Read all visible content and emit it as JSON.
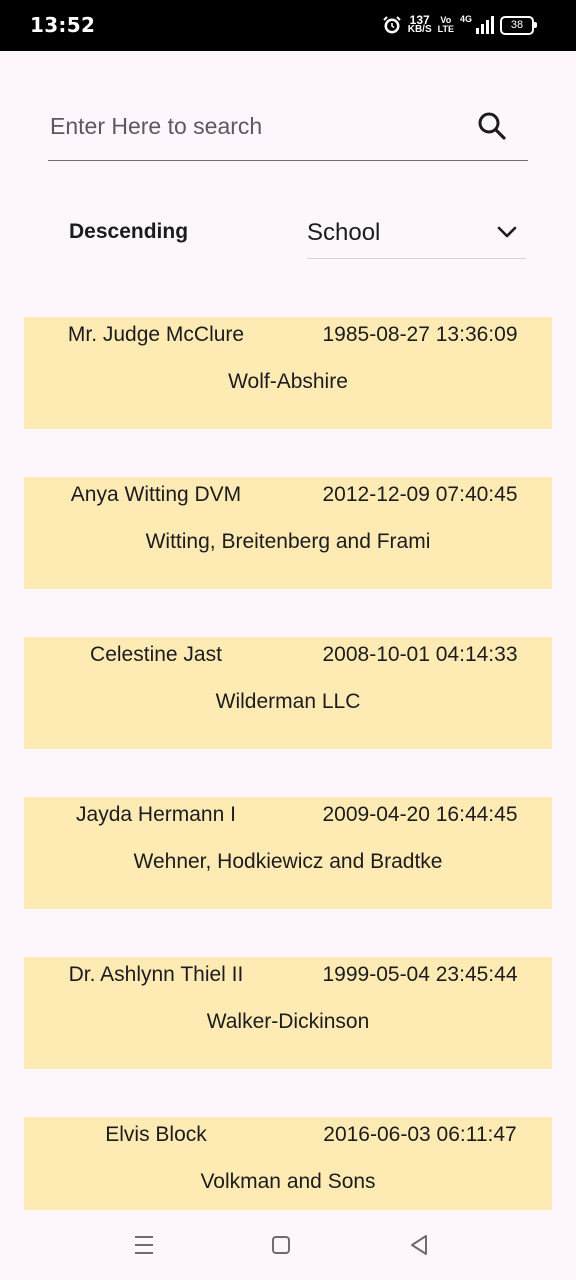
{
  "status_bar": {
    "time": "13:52",
    "net_speed_value": "137",
    "net_speed_unit": "KB/S",
    "volte_top": "Vo",
    "volte_bottom": "LTE",
    "network": "4G",
    "battery": "38"
  },
  "search": {
    "placeholder": "Enter Here to search",
    "value": ""
  },
  "sort": {
    "order_label": "Descending",
    "field_value": "School"
  },
  "records": [
    {
      "name": "Mr. Judge McClure",
      "datetime": "1985-08-27 13:36:09",
      "school": "Wolf-Abshire"
    },
    {
      "name": "Anya Witting DVM",
      "datetime": "2012-12-09 07:40:45",
      "school": "Witting, Breitenberg and Frami"
    },
    {
      "name": "Celestine Jast",
      "datetime": "2008-10-01 04:14:33",
      "school": "Wilderman LLC"
    },
    {
      "name": "Jayda Hermann I",
      "datetime": "2009-04-20 16:44:45",
      "school": "Wehner, Hodkiewicz and Bradtke"
    },
    {
      "name": "Dr. Ashlynn Thiel II",
      "datetime": "1999-05-04 23:45:44",
      "school": "Walker-Dickinson"
    },
    {
      "name": "Elvis Block",
      "datetime": "2016-06-03 06:11:47",
      "school": "Volkman and Sons"
    }
  ],
  "colors": {
    "card_background": "#feebb4",
    "page_background": "#fdf7fd"
  },
  "nav": {
    "icons": [
      "menu-icon",
      "home-square-icon",
      "back-triangle-icon"
    ]
  }
}
